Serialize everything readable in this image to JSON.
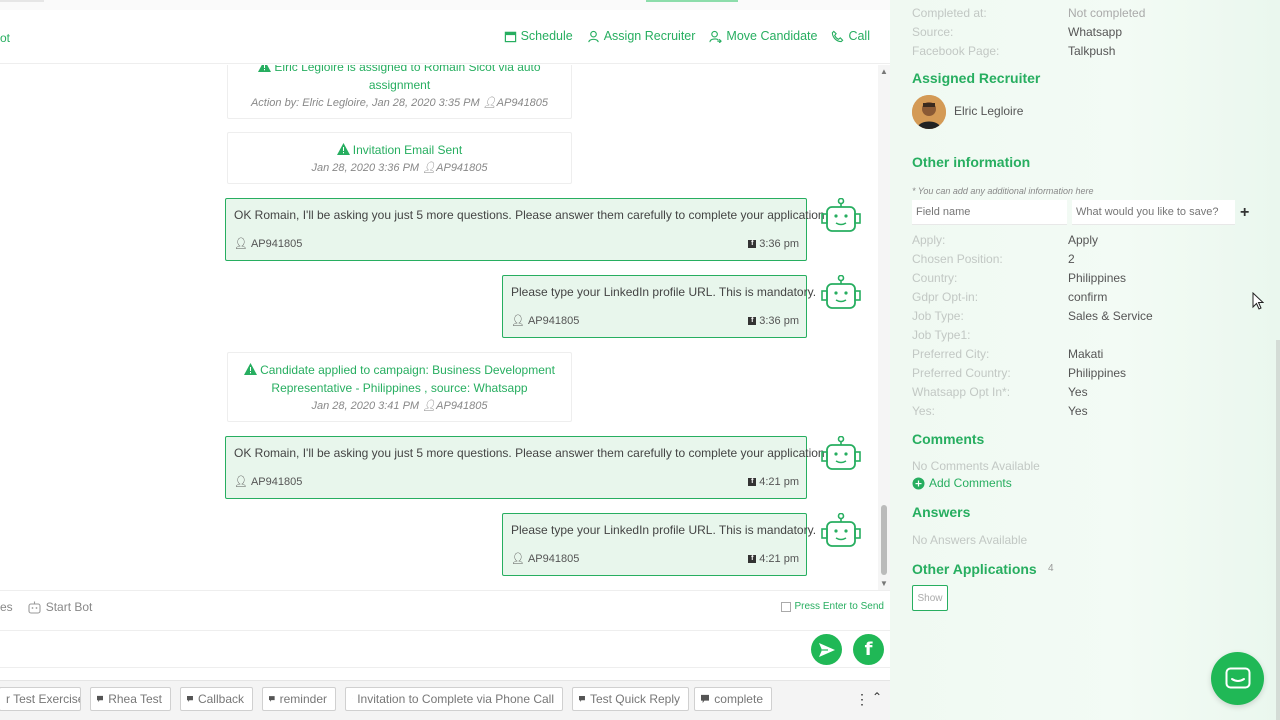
{
  "header": {
    "left_text": "ot",
    "actions": [
      {
        "label": "Schedule",
        "icon": "calendar-icon"
      },
      {
        "label": "Assign Recruiter",
        "icon": "user-icon"
      },
      {
        "label": "Move Candidate",
        "icon": "move-icon"
      },
      {
        "label": "Call",
        "icon": "phone-icon"
      }
    ]
  },
  "events": [
    {
      "title": "Elric Legloire is assigned to Romain Sicot via auto assignment",
      "meta": "Action by: Elric Legloire, Jan 28, 2020 3:35 PM",
      "agent": "AP941805"
    },
    {
      "title": "Invitation Email Sent",
      "meta": "Jan 28, 2020 3:36 PM",
      "agent": "AP941805"
    },
    {
      "title": "Candidate applied to campaign: Business Development Representative - Philippines , source: Whatsapp",
      "meta": "Jan 28, 2020 3:41 PM",
      "agent": "AP941805"
    }
  ],
  "messages": [
    {
      "text": "OK Romain, I'll be asking you just 5 more questions. Please answer them carefully to complete your application",
      "agent": "AP941805",
      "time": "3:36 pm"
    },
    {
      "text": "Please type your LinkedIn profile URL. This is mandatory.",
      "agent": "AP941805",
      "time": "3:36 pm"
    },
    {
      "text": "OK Romain, I'll be asking you just 5 more questions. Please answer them carefully to complete your application",
      "agent": "AP941805",
      "time": "4:21 pm"
    },
    {
      "text": "Please type your LinkedIn profile URL. This is mandatory.",
      "agent": "AP941805",
      "time": "4:21 pm"
    }
  ],
  "composer": {
    "left_partial": "es",
    "start_bot": "Start Bot",
    "press_enter": "Press Enter to Send",
    "placeholder": ""
  },
  "quick_replies": [
    "r Test Exercise",
    "Rhea Test",
    "Callback",
    "reminder",
    "Invitation to Complete via Phone Call",
    "Test Quick Reply",
    "complete"
  ],
  "info": {
    "top_fields": [
      {
        "label": "Completed at:",
        "value": "Not completed"
      },
      {
        "label": "Source:",
        "value": "Whatsapp"
      },
      {
        "label": "Facebook Page:",
        "value": "Talkpush"
      }
    ],
    "assigned_recruiter_title": "Assigned Recruiter",
    "recruiter_name": "Elric Legloire",
    "other_info_title": "Other information",
    "add_info_note": "* You can add any additional information here",
    "field_name_placeholder": "Field name",
    "field_value_placeholder": "What would you like to save?",
    "other_fields": [
      {
        "label": "Apply:",
        "value": "Apply"
      },
      {
        "label": "Chosen Position:",
        "value": "2"
      },
      {
        "label": "Country:",
        "value": "Philippines"
      },
      {
        "label": "Gdpr Opt-in:",
        "value": "confirm"
      },
      {
        "label": "Job Type:",
        "value": "Sales & Service"
      },
      {
        "label": "Job Type1:",
        "value": ""
      },
      {
        "label": "Preferred City:",
        "value": "Makati"
      },
      {
        "label": "Preferred Country:",
        "value": "Philippines"
      },
      {
        "label": "Whatsapp Opt In*:",
        "value": "Yes"
      },
      {
        "label": "Yes:",
        "value": "Yes"
      }
    ],
    "comments_title": "Comments",
    "no_comments": "No Comments Available",
    "add_comments": "Add Comments",
    "answers_title": "Answers",
    "no_answers": "No Answers Available",
    "other_apps_title": "Other Applications",
    "other_apps_count": "4",
    "show_label": "Show"
  },
  "colors": {
    "accent": "#27ae60",
    "bubble_bg": "#e8f6ec",
    "launcher": "#20b856"
  }
}
